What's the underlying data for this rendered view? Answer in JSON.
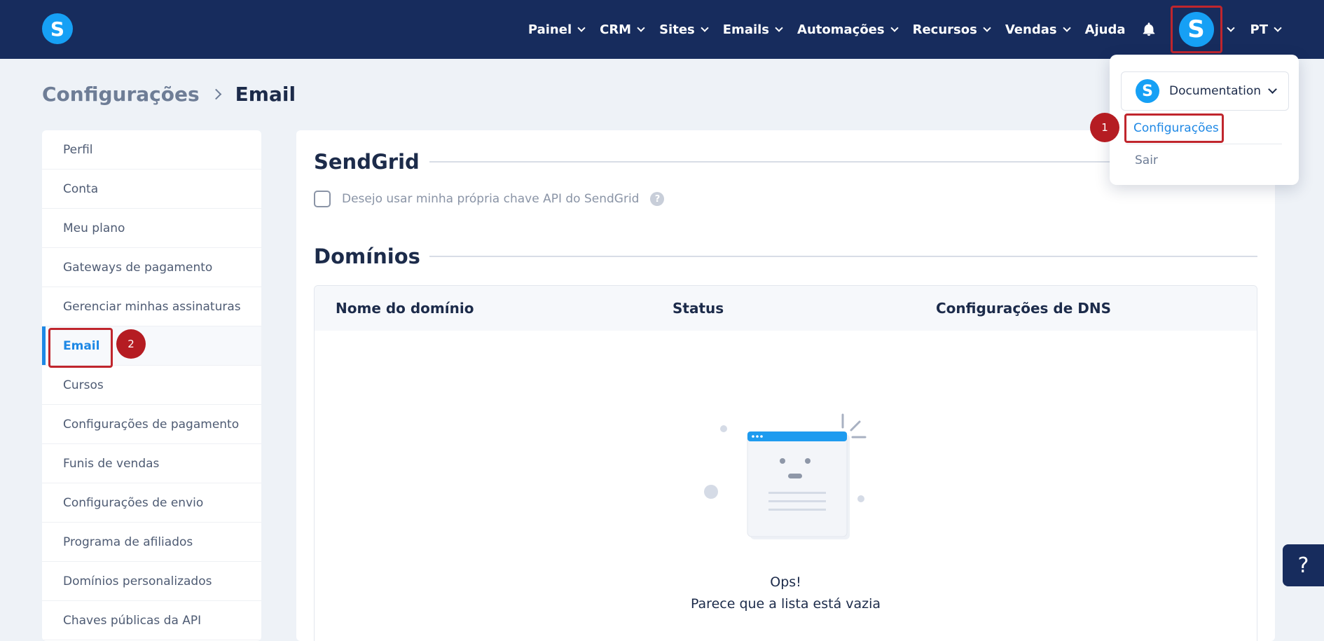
{
  "nav": {
    "items": [
      {
        "label": "Painel"
      },
      {
        "label": "CRM"
      },
      {
        "label": "Sites"
      },
      {
        "label": "Emails"
      },
      {
        "label": "Automações"
      },
      {
        "label": "Recursos"
      },
      {
        "label": "Vendas"
      }
    ],
    "ajuda": "Ajuda",
    "lang": "PT",
    "logo_letter": "S",
    "avatar_letter": "S"
  },
  "breadcrumb": {
    "parent": "Configurações",
    "current": "Email"
  },
  "sidebar": {
    "items": [
      {
        "label": "Perfil"
      },
      {
        "label": "Conta"
      },
      {
        "label": "Meu plano"
      },
      {
        "label": "Gateways de pagamento"
      },
      {
        "label": "Gerenciar minhas assinaturas"
      },
      {
        "label": "Email"
      },
      {
        "label": "Cursos"
      },
      {
        "label": "Configurações de pagamento"
      },
      {
        "label": "Funis de vendas"
      },
      {
        "label": "Configurações de envio"
      },
      {
        "label": "Programa de afiliados"
      },
      {
        "label": "Domínios personalizados"
      },
      {
        "label": "Chaves públicas da API"
      }
    ]
  },
  "sendgrid": {
    "title": "SendGrid",
    "checkbox_label": "Desejo usar minha própria chave API do SendGrid",
    "help": "?"
  },
  "domains": {
    "title": "Domínios",
    "columns": [
      "Nome do domínio",
      "Status",
      "Configurações de DNS"
    ],
    "empty_title": "Ops!",
    "empty_subtitle": "Parece que a lista está vazia"
  },
  "dropdown": {
    "org_letter": "S",
    "org_name": "Documentation",
    "config": "Configurações",
    "logout": "Sair"
  },
  "markers": [
    "1",
    "2"
  ],
  "help_float": "?",
  "colors": {
    "navbar": "#172c5d",
    "brand": "#16a0f5",
    "accent": "#1e88e5",
    "annotation": "#c0262d"
  }
}
